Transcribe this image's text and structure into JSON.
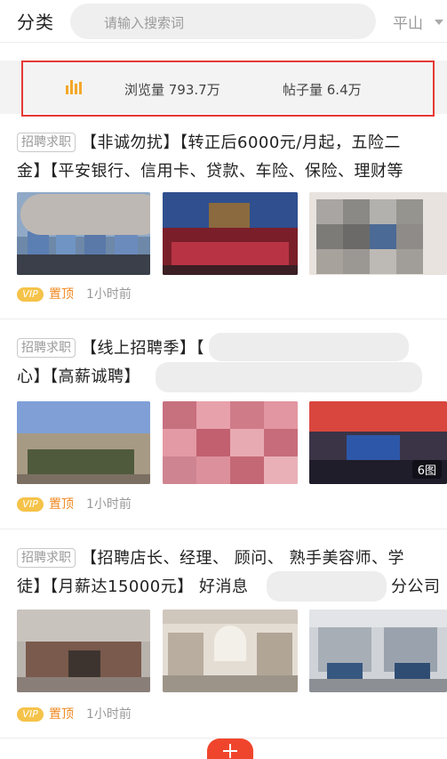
{
  "header": {
    "category_label": "分类",
    "search_placeholder": "请输入搜索词",
    "city": "平山"
  },
  "stats": {
    "views": "浏览量 793.7万",
    "posts": "帖子量 6.4万",
    "icon": "bar-chart-icon",
    "accent": "#f4a72a",
    "highlight_border": "#e53935"
  },
  "posts": [
    {
      "tag": "招聘求职",
      "line1": "【非诚勿扰】【转正后6000元/月起，五险二",
      "line2": "金】【平安银行、信用卡、贷款、车险、保险、理财等",
      "vip": "VIP",
      "pinned": "置顶",
      "time": "1小时前"
    },
    {
      "tag": "招聘求职",
      "line1": "【线上招聘季】【",
      "line2": "心】【高薪诚聘】",
      "image_count": "6图",
      "vip": "VIP",
      "pinned": "置顶",
      "time": "1小时前"
    },
    {
      "tag": "招聘求职",
      "line1": "【招聘店长、经理、 顾问、 熟手美容师、学",
      "line2": "徒】【月薪达15000元】 好消息",
      "line2_tail": "分公司",
      "vip": "VIP",
      "pinned": "置顶",
      "time": "1小时前"
    }
  ],
  "fab": {
    "icon": "plus-icon",
    "color": "#f0452d"
  }
}
